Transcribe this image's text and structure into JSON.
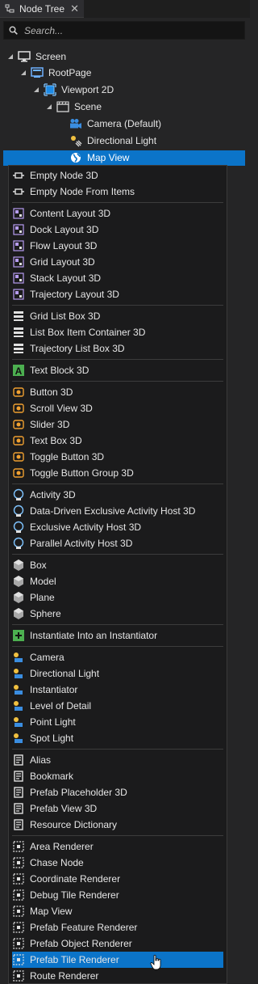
{
  "tab": {
    "title": "Node Tree",
    "icon": "node-tree-icon",
    "close": "✕"
  },
  "search": {
    "placeholder": "Search..."
  },
  "tree": [
    {
      "name": "tree-node-screen",
      "label": "Screen",
      "icon": "monitor-icon",
      "expanded": true
    },
    {
      "name": "tree-node-rootpage",
      "label": "RootPage",
      "icon": "page-icon",
      "expanded": true
    },
    {
      "name": "tree-node-viewport2d",
      "label": "Viewport 2D",
      "icon": "viewport-icon",
      "expanded": true
    },
    {
      "name": "tree-node-scene",
      "label": "Scene",
      "icon": "scene-icon",
      "expanded": true
    },
    {
      "name": "tree-node-camera",
      "label": "Camera (Default)",
      "icon": "camera-icon"
    },
    {
      "name": "tree-node-directional-light",
      "label": "Directional Light",
      "icon": "directional-light-icon"
    },
    {
      "name": "tree-node-map-view",
      "label": "Map View",
      "icon": "globe-icon",
      "selected": true
    }
  ],
  "menu": {
    "groups": [
      [
        "Empty Node 3D",
        "Empty Node From Items"
      ],
      [
        "Content Layout 3D",
        "Dock Layout 3D",
        "Flow Layout 3D",
        "Grid Layout 3D",
        "Stack Layout 3D",
        "Trajectory Layout 3D"
      ],
      [
        "Grid List Box 3D",
        "List Box Item Container 3D",
        "Trajectory List Box 3D"
      ],
      [
        "Text Block 3D"
      ],
      [
        "Button 3D",
        "Scroll View 3D",
        "Slider 3D",
        "Text Box 3D",
        "Toggle Button 3D",
        "Toggle Button Group 3D"
      ],
      [
        "Activity 3D",
        "Data-Driven Exclusive Activity Host 3D",
        "Exclusive Activity Host 3D",
        "Parallel Activity Host 3D"
      ],
      [
        "Box",
        "Model",
        "Plane",
        "Sphere"
      ],
      [
        "Instantiate Into an Instantiator"
      ],
      [
        "Camera",
        "Directional Light",
        "Instantiator",
        "Level of Detail",
        "Point Light",
        "Spot Light"
      ],
      [
        "Alias",
        "Bookmark",
        "Prefab Placeholder 3D",
        "Prefab View 3D",
        "Resource Dictionary"
      ],
      [
        "Area Renderer",
        "Chase Node",
        "Coordinate Renderer",
        "Debug Tile Renderer",
        "Map View",
        "Prefab Feature Renderer",
        "Prefab Object Renderer",
        "Prefab Tile Renderer",
        "Route Renderer"
      ]
    ],
    "highlighted": "Prefab Tile Renderer"
  },
  "colors": {
    "selection": "#0b74c9",
    "background": "#252526",
    "menu_bg": "#1b1b1c"
  }
}
